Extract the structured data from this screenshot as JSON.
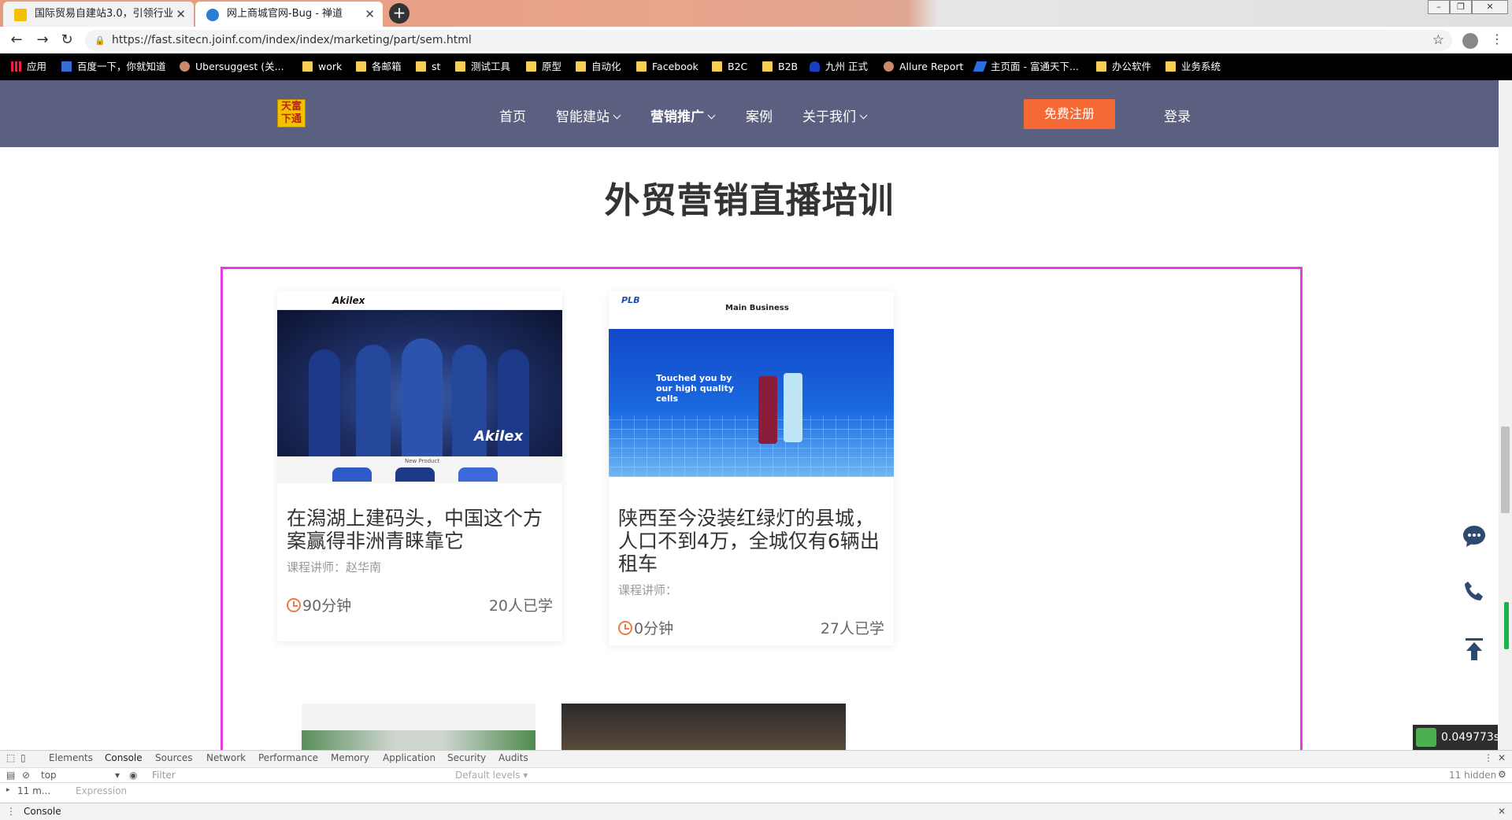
{
  "browser": {
    "tabs": [
      {
        "title": "国际贸易自建站3.0，引领行业变",
        "active": true
      },
      {
        "title": "网上商城官网-Bug - 禅道",
        "active": false
      }
    ],
    "url": "https://fast.sitecn.joinf.com/index/index/marketing/part/sem.html",
    "bookmarks": [
      "应用",
      "百度一下，你就知道",
      "Ubersuggest (关...",
      "work",
      "各邮箱",
      "st",
      "测试工具",
      "原型",
      "自动化",
      "Facebook",
      "B2C",
      "B2B",
      "九州 正式",
      "Allure Report",
      "主页面 - 富通天下...",
      "办公软件",
      "业务系统"
    ]
  },
  "site": {
    "logo_text": [
      "天",
      "富",
      "下",
      "通"
    ],
    "nav": [
      "首页",
      "智能建站",
      "营销推广",
      "案例",
      "关于我们"
    ],
    "register": "免费注册",
    "login": "登录"
  },
  "page": {
    "title": "外贸营销直播培训",
    "courses": [
      {
        "title": "在潟湖上建码头，中国这个方案赢得非洲青睐靠它",
        "teacher": "课程讲师：赵华南",
        "duration": "90分钟",
        "learners": "20人已学",
        "thumb_brand": "Akilex",
        "thumb_caption": "New Product"
      },
      {
        "title": "陕西至今没装红绿灯的县城，人口不到4万，全城仅有6辆出租车",
        "teacher": "课程讲师：",
        "duration": "0分钟",
        "learners": "27人已学",
        "thumb_brand": "PLB",
        "thumb_heading": "Main Business",
        "thumb_caption": "Touched you by our high quality cells"
      }
    ]
  },
  "perf": "0.049773s",
  "devtools": {
    "tabs": [
      "Elements",
      "Console",
      "Sources",
      "Network",
      "Performance",
      "Memory",
      "Application",
      "Security",
      "Audits"
    ],
    "context": "top",
    "filter_placeholder": "Filter",
    "levels": "Default levels",
    "hidden": "11 hidden",
    "expression_placeholder": "Expression",
    "msg_count": "11 m...",
    "drawer_tab": "Console"
  }
}
